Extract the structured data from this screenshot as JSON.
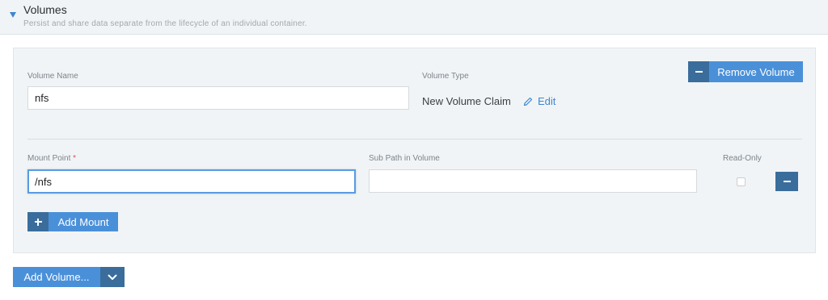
{
  "section": {
    "title": "Volumes",
    "description": "Persist and share data separate from the lifecycle of an individual container."
  },
  "volume": {
    "name_label": "Volume Name",
    "name_value": "nfs",
    "type_label": "Volume Type",
    "type_value": "New Volume Claim",
    "edit_label": "Edit",
    "remove_label": "Remove Volume"
  },
  "mount": {
    "mount_point_label": "Mount Point",
    "required_marker": "*",
    "mount_point_value": "/nfs",
    "sub_path_label": "Sub Path in Volume",
    "sub_path_value": "",
    "read_only_label": "Read-Only",
    "read_only_checked": false,
    "add_mount_label": "Add Mount"
  },
  "footer": {
    "add_volume_label": "Add Volume..."
  },
  "colors": {
    "primary": "#4a90d9",
    "primary_dark": "#3a6d9c",
    "panel_bg": "#f1f4f6",
    "focus_border": "#5b9be0"
  },
  "icons": [
    "caret-down-icon",
    "minus-icon",
    "pencil-icon",
    "plus-icon",
    "chevron-down-icon"
  ]
}
